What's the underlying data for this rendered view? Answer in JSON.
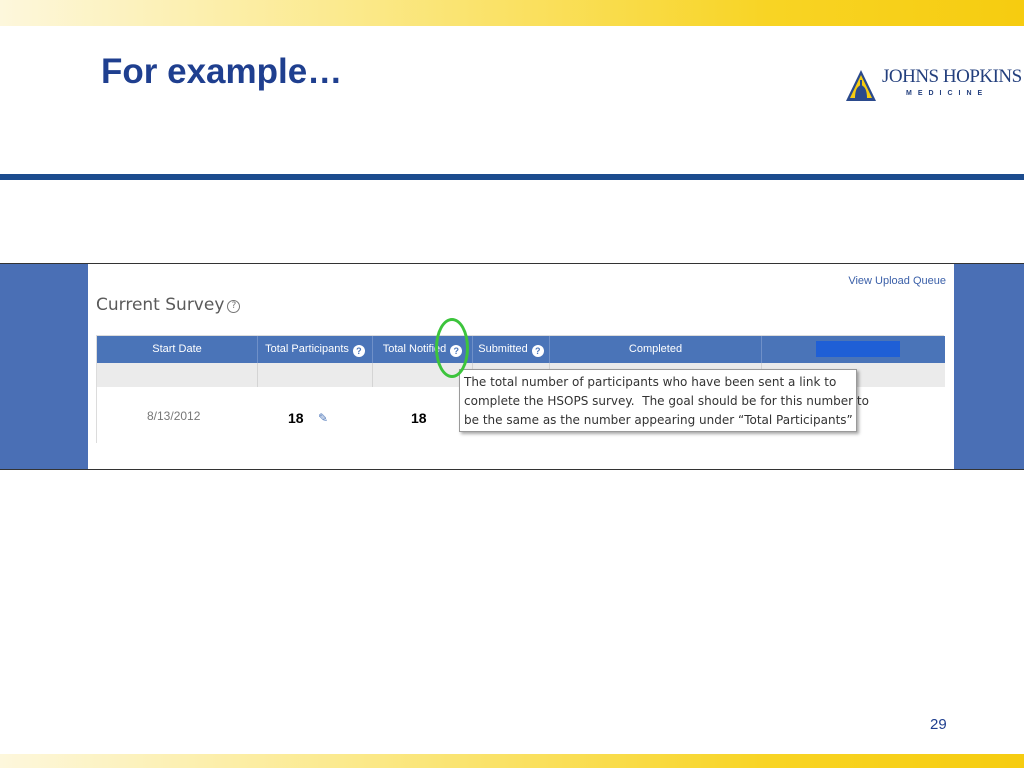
{
  "slide": {
    "title": "For example…",
    "page_number": "29"
  },
  "logo": {
    "name": "JOHNS HOPKINS",
    "sub": "MEDICINE",
    "icon": "dome-icon"
  },
  "survey": {
    "upload_link": "View Upload Queue",
    "title": "Current Survey",
    "title_help_icon": "?",
    "columns": [
      {
        "label": "Start Date"
      },
      {
        "label": "Total Participants",
        "help": "?"
      },
      {
        "label": "Total Notified",
        "help": "?"
      },
      {
        "label": "Submitted",
        "help": "?"
      },
      {
        "label": "Completed"
      }
    ],
    "row": {
      "start_date": "8/13/2012",
      "total_participants": "18",
      "total_notified": "18"
    },
    "tooltip": "The total number of participants who have been sent a link to\ncomplete the HSOPS survey.  The goal should be for this number to\nbe the same as the number appearing under “Total Participants”"
  },
  "colors": {
    "title_blue": "#1f3f8f",
    "header_blue": "#4a74b8",
    "highlight_green": "#3cc43c",
    "band_yellow": "#f6cc10"
  }
}
